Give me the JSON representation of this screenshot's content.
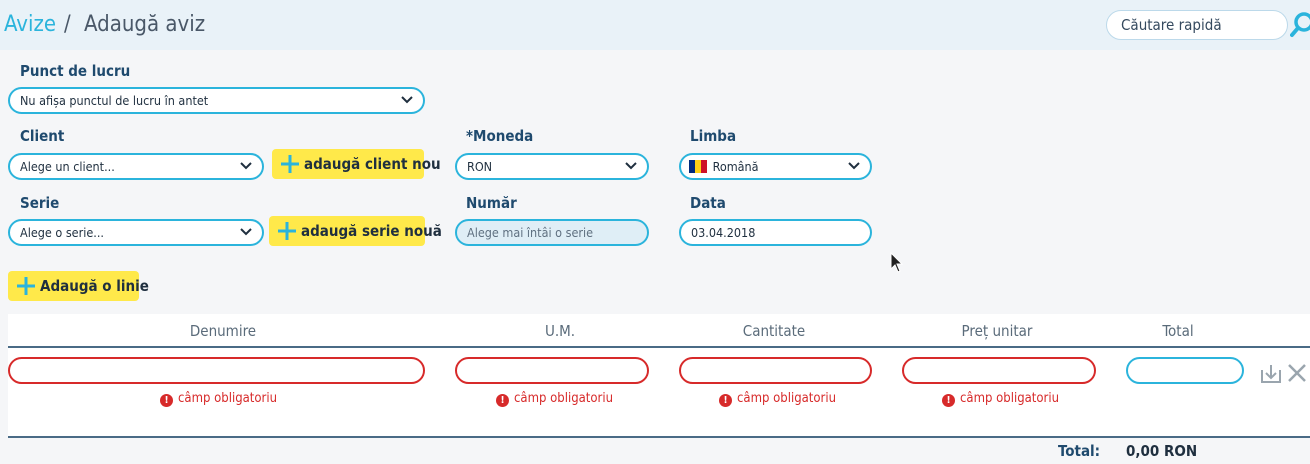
{
  "breadcrumb": {
    "parent": "Avize",
    "separator": "/",
    "current": "Adaugă aviz"
  },
  "search": {
    "placeholder": "Căutare rapidă"
  },
  "form": {
    "punct_label": "Punct de lucru",
    "punct_value": "Nu afișa punctul de lucru în antet",
    "client_label": "Client",
    "client_value": "Alege un client...",
    "add_client": "adaugă client nou",
    "moneda_label": "*Moneda",
    "moneda_value": "RON",
    "limba_label": "Limba",
    "limba_value": "Română",
    "serie_label": "Serie",
    "serie_value": "Alege o serie...",
    "add_serie": "adaugă serie nouă",
    "numar_label": "Număr",
    "numar_value": "Alege mai întâi o serie",
    "data_label": "Data",
    "data_value": "03.04.2018"
  },
  "add_line": "Adaugă o linie",
  "table": {
    "headers": [
      "Denumire",
      "U.M.",
      "Cantitate",
      "Preț unitar",
      "Total"
    ],
    "error": "câmp obligatoriu",
    "total_label": "Total:",
    "total_value": "0,00 RON"
  },
  "colors": {
    "accent": "#2bb4dc",
    "button": "#ffe94a",
    "error": "#d72a2a",
    "label": "#1f4a6e"
  },
  "icons": [
    "search-icon",
    "chevron-down-icon",
    "plus-icon",
    "romania-flag-icon",
    "error-icon",
    "download-icon",
    "close-icon",
    "cursor-icon"
  ]
}
